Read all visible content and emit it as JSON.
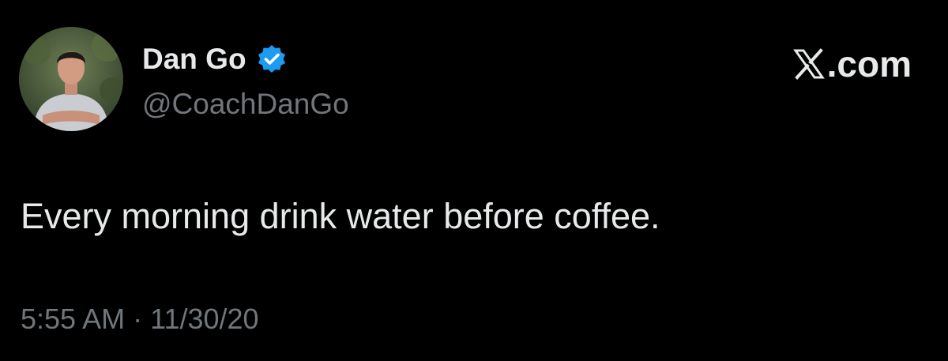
{
  "author": {
    "display_name": "Dan Go",
    "handle": "@CoachDanGo",
    "verified": true,
    "avatar_icon": "profile-photo"
  },
  "brand": {
    "logo_icon": "x-logo-icon",
    "text": ".com"
  },
  "tweet": {
    "text": "Every morning drink water before coffee.",
    "time": "5:55 AM",
    "separator": "·",
    "date": "11/30/20"
  },
  "colors": {
    "background": "#000000",
    "primary_text": "#e7e9ea",
    "secondary_text": "#71767b",
    "verified_blue": "#1d9bf0"
  }
}
